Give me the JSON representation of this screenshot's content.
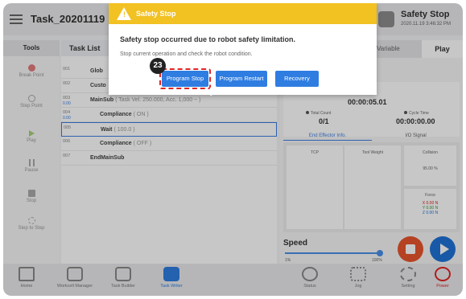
{
  "header": {
    "task_title": "Task_20201119",
    "status_title": "Safety Stop",
    "status_time": "2020.11.19 3:46:32 PM"
  },
  "tools": {
    "heading": "Tools",
    "items": [
      {
        "label": "Break Point"
      },
      {
        "label": "Step Point"
      },
      {
        "label": "Play"
      },
      {
        "label": "Pause"
      },
      {
        "label": "Stop"
      },
      {
        "label": "Step to Step"
      }
    ]
  },
  "tasklist": {
    "heading": "Task List",
    "rows": [
      {
        "num": "001",
        "num2": "",
        "text": "Glob",
        "sub": ""
      },
      {
        "num": "002",
        "num2": "",
        "text": "Custo",
        "sub": ""
      },
      {
        "num": "003",
        "num2": "0.00",
        "text": "MainSub",
        "sub": "( Task Vel. 250.000, Acc. 1,000 ~ )"
      },
      {
        "num": "004",
        "num2": "0.00",
        "text": "Compliance",
        "sub": "( ON )"
      },
      {
        "num": "005",
        "num2": "",
        "text": "Wait",
        "sub": "( 100.0 )"
      },
      {
        "num": "006",
        "num2": "",
        "text": "Compliance",
        "sub": "( OFF )"
      },
      {
        "num": "007",
        "num2": "",
        "text": "EndMainSub",
        "sub": ""
      }
    ]
  },
  "right": {
    "tab_variable": "Variable",
    "tab_play": "Play",
    "time_label": "Time",
    "time_value": "00:00:05.01",
    "total_count_label": "Total Count",
    "total_count_value": "0/1",
    "cycle_time_label": "Cycle Time",
    "cycle_time_value": "00:00:00.00",
    "subtab_end_effector": "End Effector Info.",
    "subtab_io": "I/O Signal",
    "tcp_label": "TCP",
    "tool_weight_label": "Tool Weight",
    "collision_label": "Collision",
    "collision_value": "95.00 %",
    "force_label": "Force",
    "force_x": "X 0.00 N",
    "force_y": "Y 0.00 N",
    "force_z": "Z 0.00 N",
    "speed_label": "Speed",
    "speed_min": "1%",
    "speed_max": "100%",
    "speed_level_percent": 100
  },
  "bottom": {
    "items": [
      {
        "label": "Home"
      },
      {
        "label": "Workcell Manager"
      },
      {
        "label": "Task Builder"
      },
      {
        "label": "Task Writer"
      },
      {
        "label": "Status"
      },
      {
        "label": "Jog"
      },
      {
        "label": "Setting"
      },
      {
        "label": "Power"
      }
    ]
  },
  "dialog": {
    "title": "Safety Stop",
    "message": "Safety stop occurred due to robot safety limitation.",
    "sub_message": "Stop current operation and check the robot condition.",
    "btn_program_stop": "Program Stop",
    "btn_program_restart": "Program Restart",
    "btn_recovery": "Recovery",
    "step_badge": "23"
  },
  "colors": {
    "accent": "#2f7de1",
    "warning": "#f2c122",
    "stop": "#e8552e",
    "play": "#1f73d6",
    "highlight": "#e02424"
  }
}
